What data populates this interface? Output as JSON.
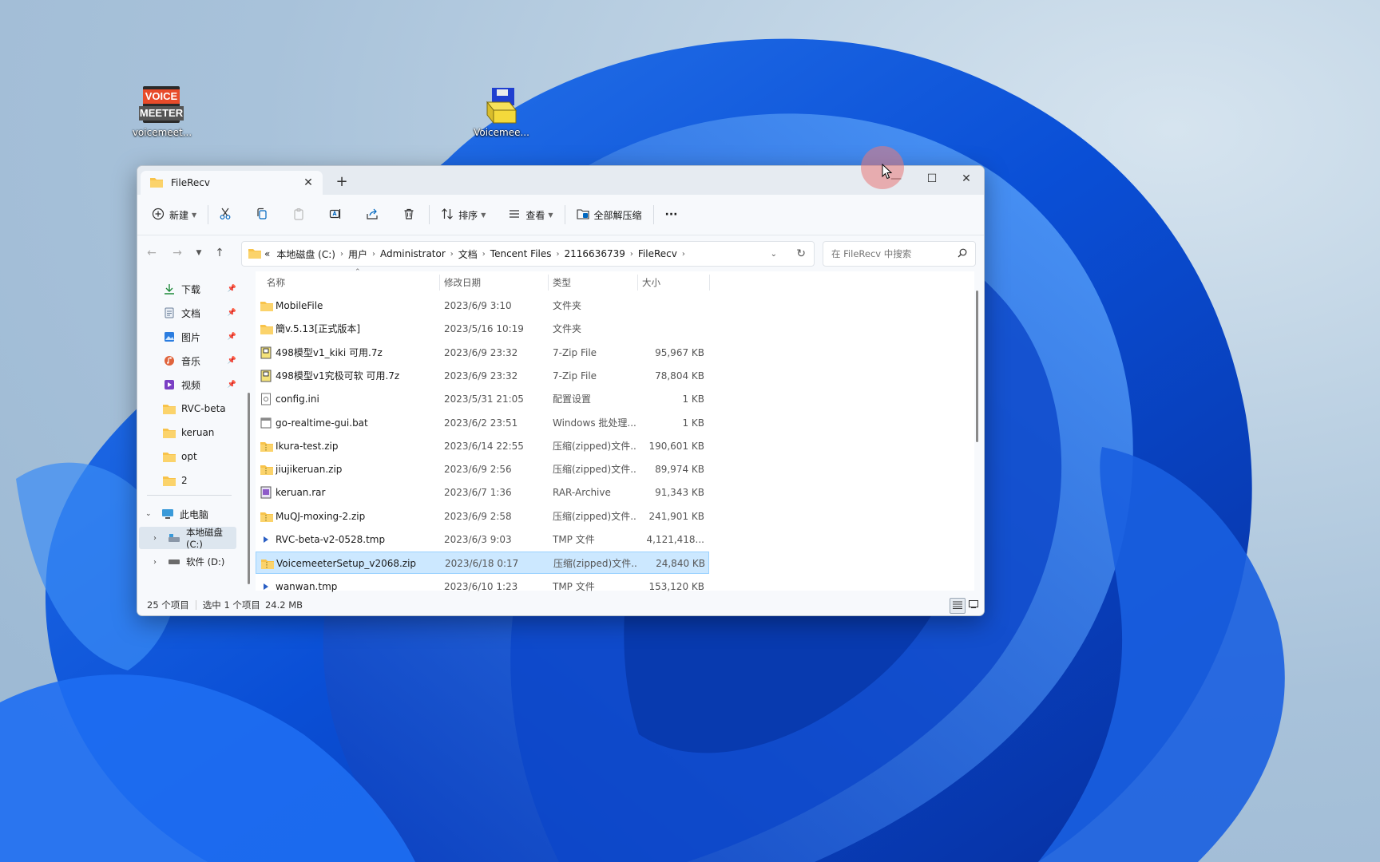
{
  "desktop": {
    "icons": [
      {
        "label": "voicemeet...",
        "logo_top": "VOICE",
        "logo_bottom": "MEETER"
      },
      {
        "label": "Voicemee..."
      }
    ]
  },
  "window": {
    "tab_title": "FileRecv",
    "tab_close": "✕",
    "new_tab": "+",
    "controls": {
      "minimize": "—",
      "maximize": "☐",
      "close": "✕"
    }
  },
  "toolbar": {
    "new_label": "新建",
    "sort_label": "排序",
    "view_label": "查看",
    "extract_label": "全部解压缩",
    "more_label": "···"
  },
  "address": {
    "overflow": "«",
    "crumbs": [
      "本地磁盘 (C:)",
      "用户",
      "Administrator",
      "文档",
      "Tencent Files",
      "2116636739",
      "FileRecv"
    ],
    "search_placeholder": "在 FileRecv 中搜索"
  },
  "sidebar": {
    "items": [
      {
        "label": "下载",
        "icon": "download-icon",
        "pinned": true
      },
      {
        "label": "文档",
        "icon": "document-icon",
        "pinned": true
      },
      {
        "label": "图片",
        "icon": "picture-icon",
        "pinned": true
      },
      {
        "label": "音乐",
        "icon": "music-icon",
        "pinned": true
      },
      {
        "label": "视频",
        "icon": "video-icon",
        "pinned": true
      },
      {
        "label": "RVC-beta",
        "icon": "folder-icon",
        "pinned": false
      },
      {
        "label": "keruan",
        "icon": "folder-icon",
        "pinned": false
      },
      {
        "label": "opt",
        "icon": "folder-icon",
        "pinned": false
      },
      {
        "label": "2",
        "icon": "folder-icon",
        "pinned": false
      }
    ],
    "this_pc": "此电脑",
    "drives": [
      {
        "label": "本地磁盘 (C:)",
        "selected": true
      },
      {
        "label": "软件 (D:)",
        "selected": false
      }
    ]
  },
  "columns": {
    "name": "名称",
    "date": "修改日期",
    "type": "类型",
    "size": "大小"
  },
  "files": [
    {
      "name": "MobileFile",
      "date": "2023/6/9 3:10",
      "type": "文件夹",
      "size": "",
      "icon": "folder"
    },
    {
      "name": "簡v.5.13[正式版本]",
      "date": "2023/5/16 10:19",
      "type": "文件夹",
      "size": "",
      "icon": "folder"
    },
    {
      "name": "498模型v1_kiki 可用.7z",
      "date": "2023/6/9 23:32",
      "type": "7-Zip File",
      "size": "95,967 KB",
      "icon": "7z"
    },
    {
      "name": "498模型v1究极可软 可用.7z",
      "date": "2023/6/9 23:32",
      "type": "7-Zip File",
      "size": "78,804 KB",
      "icon": "7z"
    },
    {
      "name": "config.ini",
      "date": "2023/5/31 21:05",
      "type": "配置设置",
      "size": "1 KB",
      "icon": "ini"
    },
    {
      "name": "go-realtime-gui.bat",
      "date": "2023/6/2 23:51",
      "type": "Windows 批处理...",
      "size": "1 KB",
      "icon": "bat"
    },
    {
      "name": "Ikura-test.zip",
      "date": "2023/6/14 22:55",
      "type": "压缩(zipped)文件...",
      "size": "190,601 KB",
      "icon": "zip"
    },
    {
      "name": "jiujikeruan.zip",
      "date": "2023/6/9 2:56",
      "type": "压缩(zipped)文件...",
      "size": "89,974 KB",
      "icon": "zip"
    },
    {
      "name": "keruan.rar",
      "date": "2023/6/7 1:36",
      "type": "RAR-Archive",
      "size": "91,343 KB",
      "icon": "rar"
    },
    {
      "name": "MuQJ-moxing-2.zip",
      "date": "2023/6/9 2:58",
      "type": "压缩(zipped)文件...",
      "size": "241,901 KB",
      "icon": "zip"
    },
    {
      "name": "RVC-beta-v2-0528.tmp",
      "date": "2023/6/3 9:03",
      "type": "TMP 文件",
      "size": "4,121,418...",
      "icon": "tmp"
    },
    {
      "name": "VoicemeeterSetup_v2068.zip",
      "date": "2023/6/18 0:17",
      "type": "压缩(zipped)文件...",
      "size": "24,840 KB",
      "icon": "zip",
      "selected": true
    },
    {
      "name": "wanwan.tmp",
      "date": "2023/6/10 1:23",
      "type": "TMP 文件",
      "size": "153,120 KB",
      "icon": "tmp"
    }
  ],
  "status": {
    "count": "25 个项目",
    "selected": "选中 1 个项目",
    "size": "24.2 MB"
  },
  "colors": {
    "accent": "#0067c0",
    "selection": "#cce8ff",
    "folder": "#f8c34a"
  }
}
